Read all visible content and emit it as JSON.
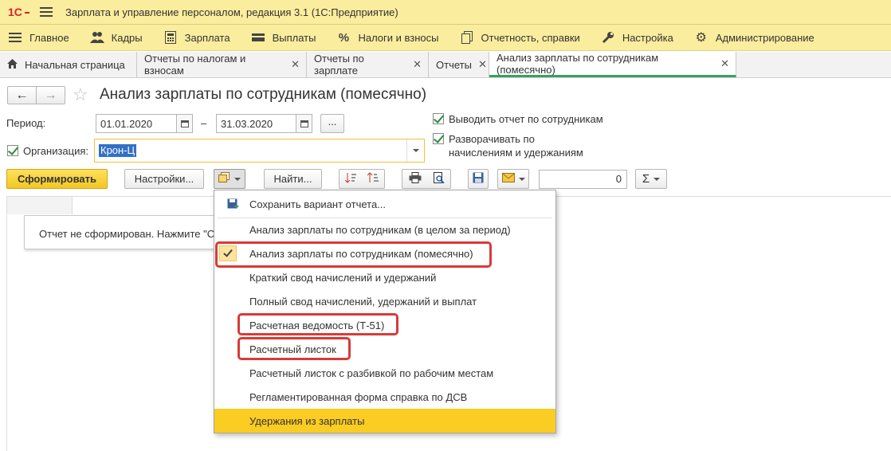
{
  "window": {
    "title": "Зарплата и управление персоналом, редакция 3.1  (1С:Предприятие)"
  },
  "menu": [
    {
      "label": "Главное",
      "icon": "hamburger-icon"
    },
    {
      "label": "Кадры",
      "icon": "people-icon"
    },
    {
      "label": "Зарплата",
      "icon": "calculator-icon"
    },
    {
      "label": "Выплаты",
      "icon": "wallet-icon"
    },
    {
      "label": "Налоги и взносы",
      "icon": "percent-icon"
    },
    {
      "label": "Отчетность, справки",
      "icon": "documents-icon"
    },
    {
      "label": "Настройка",
      "icon": "wrench-icon"
    },
    {
      "label": "Администрирование",
      "icon": "gear-icon"
    }
  ],
  "tabs": [
    {
      "label": "Начальная страница"
    },
    {
      "label": "Отчеты по налогам и взносам"
    },
    {
      "label": "Отчеты по зарплате"
    },
    {
      "label": "Отчеты"
    },
    {
      "label": "Анализ зарплаты по сотрудникам (помесячно)"
    }
  ],
  "form": {
    "title": "Анализ зарплаты по сотрудникам (помесячно)",
    "period_label": "Период:",
    "date_from": "01.01.2020",
    "date_separator": "–",
    "date_to": "31.03.2020",
    "dots_label": "...",
    "org_label": "Организация:",
    "org_value": "Крон-Ц",
    "opt_by_employee": "Выводить отчет по сотрудникам",
    "opt_expand_1": "Разворачивать по",
    "opt_expand_2": "начислениям и удержаниям"
  },
  "toolbar": {
    "generate": "Сформировать",
    "settings": "Настройки...",
    "find": "Найти...",
    "sum_value": "0",
    "sum_icon": "Σ"
  },
  "content": {
    "notice": "Отчет не сформирован. Нажмите \"Сформировать\""
  },
  "dropdown": {
    "items": [
      {
        "label": "Сохранить вариант отчета..."
      },
      {
        "label": "Анализ зарплаты по сотрудникам (в целом за период)"
      },
      {
        "label": "Анализ зарплаты по сотрудникам (помесячно)"
      },
      {
        "label": "Краткий свод начислений и удержаний"
      },
      {
        "label": "Полный свод начислений, удержаний и выплат"
      },
      {
        "label": "Расчетная ведомость (Т-51)"
      },
      {
        "label": "Расчетный листок"
      },
      {
        "label": "Расчетный листок с разбивкой по рабочим местам"
      },
      {
        "label": "Регламентированная форма справка по ДСВ"
      },
      {
        "label": "Удержания из зарплаты"
      }
    ],
    "highlight_color": "#fbcc22",
    "annotation_color": "#d93a3a"
  }
}
